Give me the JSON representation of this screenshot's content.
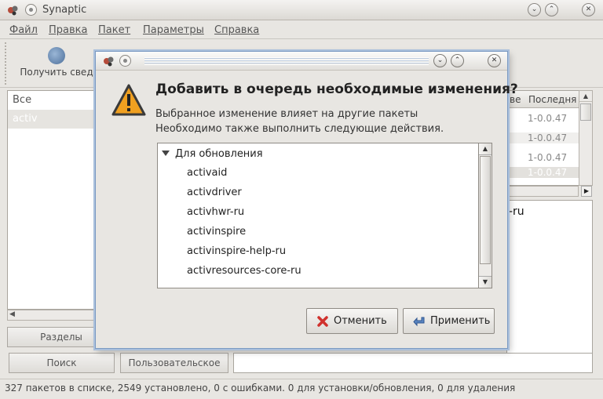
{
  "main_window": {
    "title": "Synaptic",
    "controls": {
      "minimize": "⌄",
      "maximize": "⌃",
      "close": "✕"
    }
  },
  "menubar": [
    "Файл",
    "Правка",
    "Пакет",
    "Параметры",
    "Справка"
  ],
  "toolbar": {
    "reload_label": "Получить свед"
  },
  "left_panel": {
    "items": [
      "Все",
      "activ"
    ],
    "sections_button": "Разделы",
    "search_button": "Поиск",
    "custom_button": "Пользовательское"
  },
  "package_table": {
    "col_version_partial": "ве",
    "col_latest": "Последня",
    "rows": [
      "1-0.0.47",
      "1-0.0.47",
      "1-0.0.47",
      "1-0.0.47"
    ]
  },
  "description_partial": "-ru",
  "statusbar": "327 пакетов в списке, 2549 установлено, 0 с ошибками. 0 для установки/обновления, 0 для удаления",
  "dialog": {
    "heading": "Добавить в очередь необходимые изменения?",
    "text_line1": "Выбранное изменение влияет на другие пакеты",
    "text_line2": "Необходимо также выполнить следующие действия.",
    "group_label": "Для обновления",
    "items": [
      "activaid",
      "activdriver",
      "activhwr-ru",
      "activinspire",
      "activinspire-help-ru",
      "activresources-core-ru"
    ],
    "cancel_label": "Отменить",
    "apply_label": "Применить",
    "controls": {
      "minimize": "⌄",
      "maximize": "⌃",
      "close": "✕"
    }
  },
  "colors": {
    "dialog_border": "#7b9ac2",
    "warning_fill": "#f0a020",
    "cancel_icon": "#d0312d",
    "apply_icon": "#5a86c2"
  }
}
